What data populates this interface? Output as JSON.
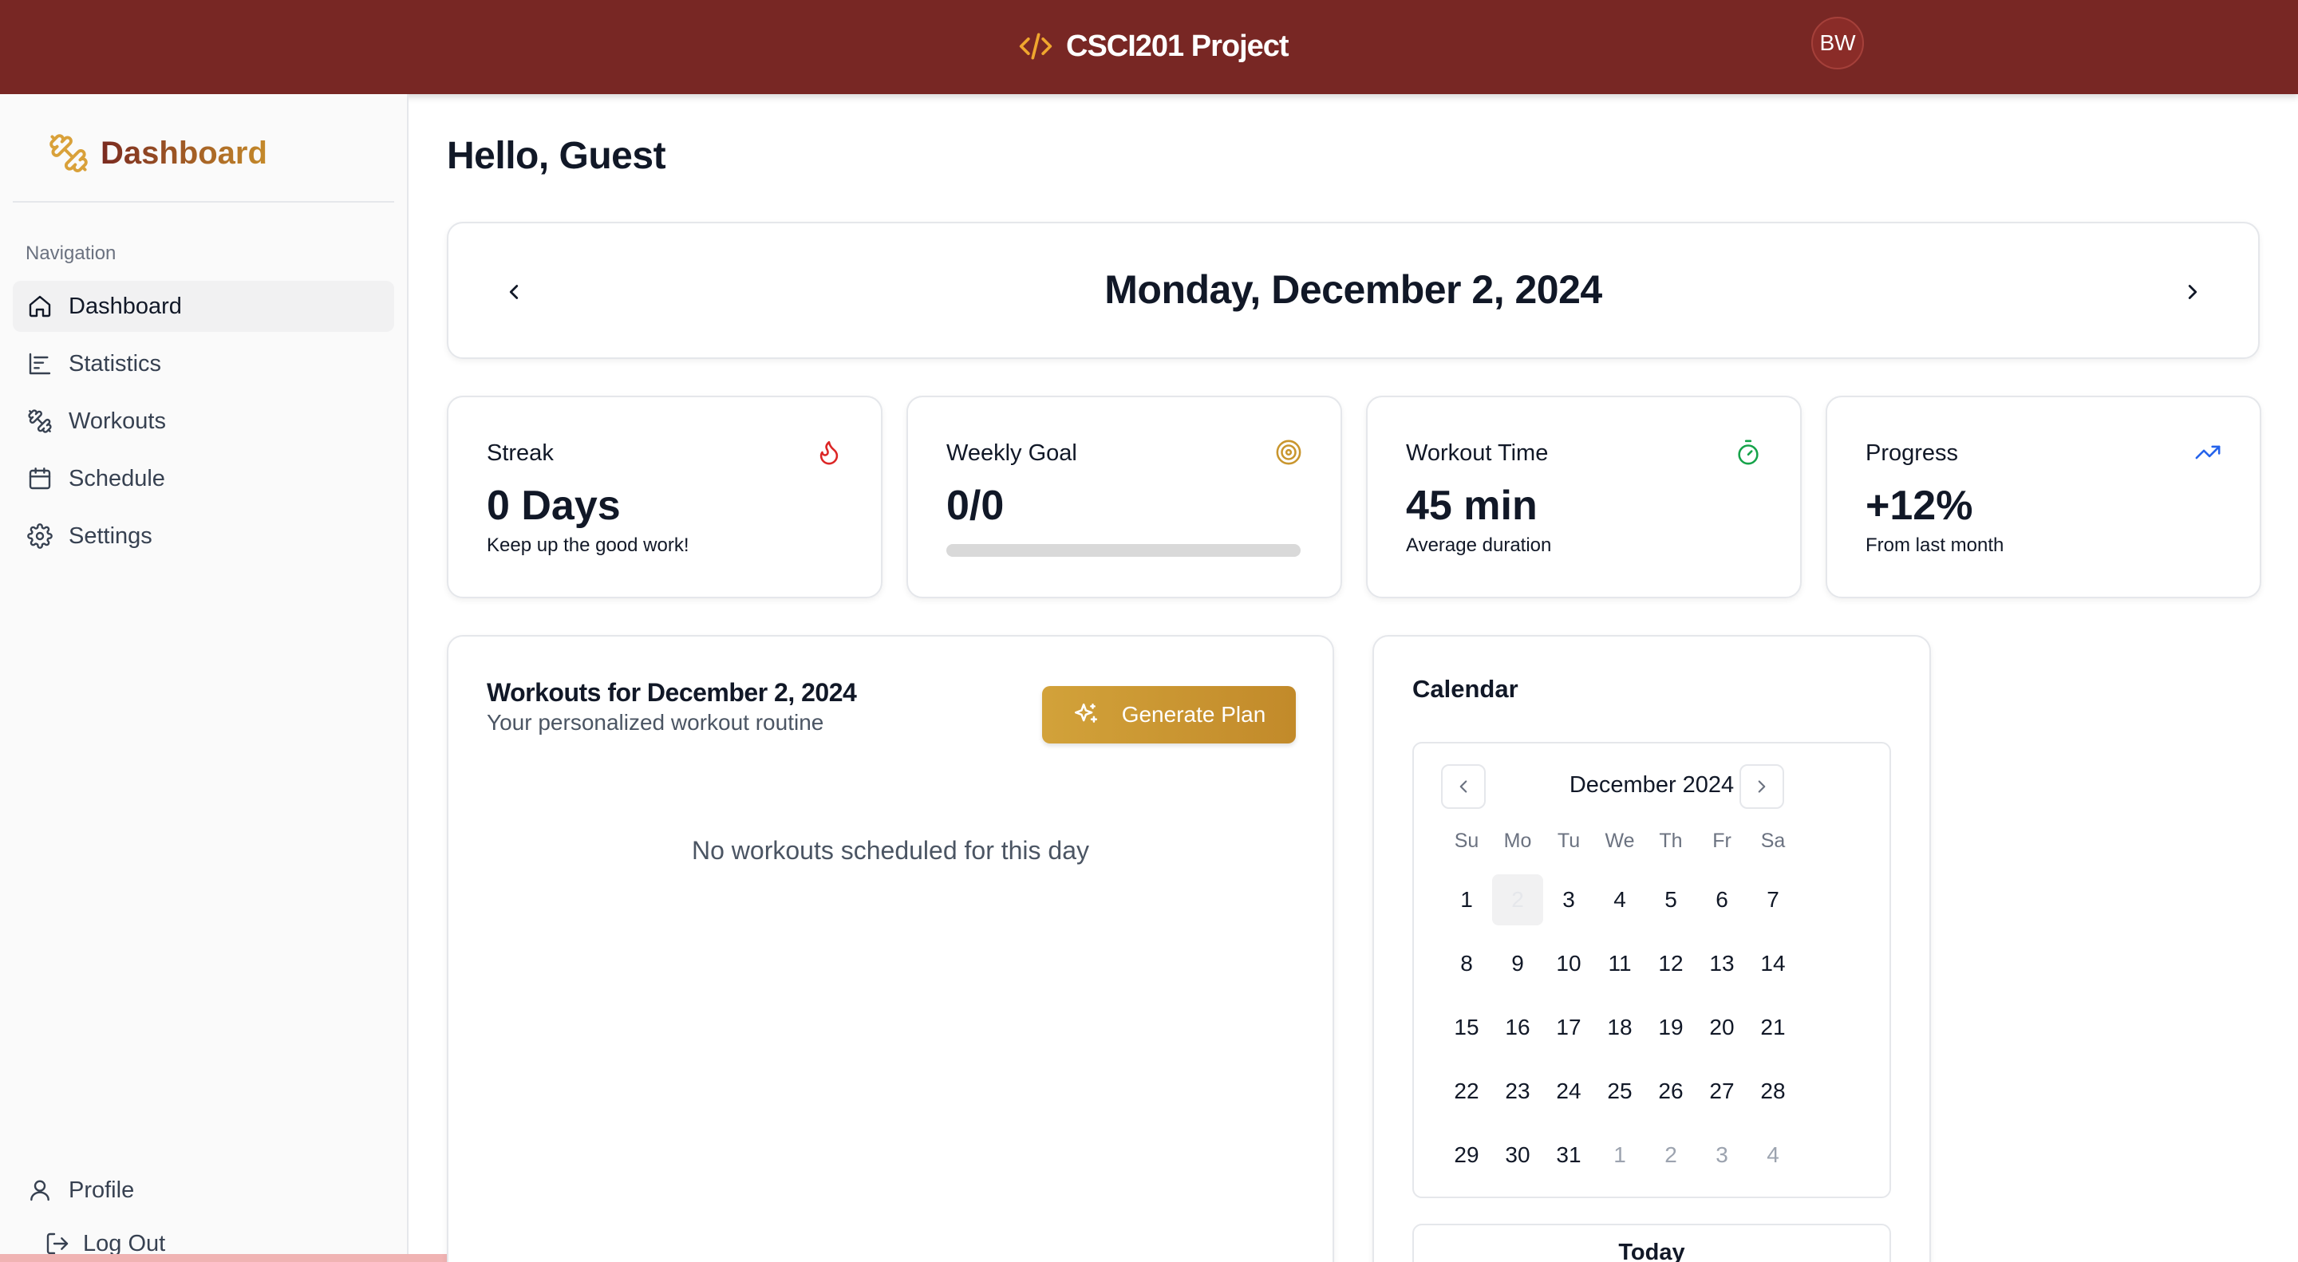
{
  "header": {
    "title": "CSCI201 Project",
    "avatar_initials": "BW",
    "colors": {
      "background": "#782724",
      "accent": "#f0a62e"
    }
  },
  "sidebar": {
    "title": "Dashboard",
    "nav_label": "Navigation",
    "items": [
      {
        "label": "Dashboard",
        "icon": "home-icon",
        "active": true
      },
      {
        "label": "Statistics",
        "icon": "bar-chart-icon",
        "active": false
      },
      {
        "label": "Workouts",
        "icon": "dumbbell-icon",
        "active": false
      },
      {
        "label": "Schedule",
        "icon": "calendar-icon",
        "active": false
      },
      {
        "label": "Settings",
        "icon": "gear-icon",
        "active": false
      }
    ],
    "profile_label": "Profile",
    "logout_label": "Log Out"
  },
  "main": {
    "greeting": "Hello, Guest",
    "date_title": "Monday, December 2, 2024",
    "stats": [
      {
        "title": "Streak",
        "value": "0 Days",
        "subtitle": "Keep up the good work!",
        "icon": "flame-icon",
        "icon_color": "#dc2626"
      },
      {
        "title": "Weekly Goal",
        "value": "0/0",
        "progress": 0,
        "icon": "target-icon",
        "icon_color": "#c9962e"
      },
      {
        "title": "Workout Time",
        "value": "45 min",
        "subtitle": "Average duration",
        "icon": "timer-icon",
        "icon_color": "#16a34a"
      },
      {
        "title": "Progress",
        "value": "+12%",
        "subtitle": "From last month",
        "icon": "trending-up-icon",
        "icon_color": "#2563eb"
      }
    ],
    "workouts": {
      "title": "Workouts for December 2, 2024",
      "subtitle": "Your personalized workout routine",
      "generate_label": "Generate Plan",
      "empty_message": "No workouts scheduled for this day"
    },
    "calendar": {
      "heading": "Calendar",
      "month_label": "December 2024",
      "weekdays": [
        "Su",
        "Mo",
        "Tu",
        "We",
        "Th",
        "Fr",
        "Sa"
      ],
      "days": [
        {
          "d": "1"
        },
        {
          "d": "2",
          "selected": true
        },
        {
          "d": "3"
        },
        {
          "d": "4"
        },
        {
          "d": "5"
        },
        {
          "d": "6"
        },
        {
          "d": "7"
        },
        {
          "d": "8"
        },
        {
          "d": "9"
        },
        {
          "d": "10"
        },
        {
          "d": "11"
        },
        {
          "d": "12"
        },
        {
          "d": "13"
        },
        {
          "d": "14"
        },
        {
          "d": "15"
        },
        {
          "d": "16"
        },
        {
          "d": "17"
        },
        {
          "d": "18"
        },
        {
          "d": "19"
        },
        {
          "d": "20"
        },
        {
          "d": "21"
        },
        {
          "d": "22"
        },
        {
          "d": "23"
        },
        {
          "d": "24"
        },
        {
          "d": "25"
        },
        {
          "d": "26"
        },
        {
          "d": "27"
        },
        {
          "d": "28"
        },
        {
          "d": "29"
        },
        {
          "d": "30"
        },
        {
          "d": "31"
        },
        {
          "d": "1",
          "outside": true
        },
        {
          "d": "2",
          "outside": true
        },
        {
          "d": "3",
          "outside": true
        },
        {
          "d": "4",
          "outside": true
        }
      ],
      "today_label": "Today"
    }
  }
}
